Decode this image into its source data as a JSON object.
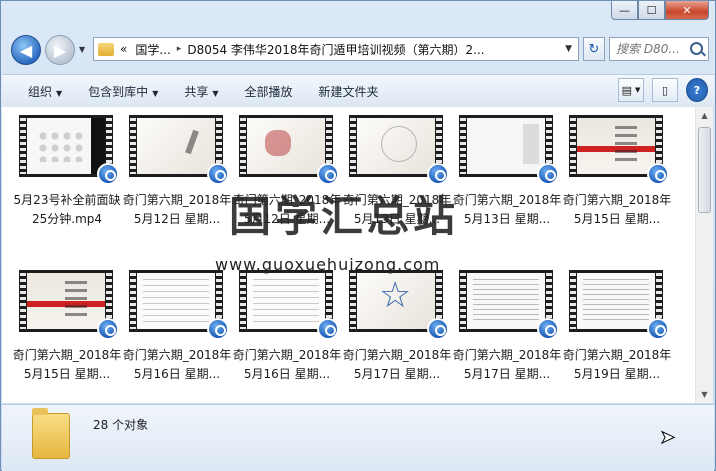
{
  "window": {
    "min": "—",
    "max": "☐",
    "close": "✕"
  },
  "nav": {
    "back": "◀",
    "forward": "▶",
    "dropdown": "▼",
    "refresh": "↻"
  },
  "address": {
    "breadcrumbs": [
      "«",
      "国学...",
      "D8054 李伟华2018年奇门遁甲培训视频（第六期）2..."
    ],
    "separator": "▸",
    "dropdown": "▼"
  },
  "search": {
    "placeholder": "搜索 D80..."
  },
  "toolbar": {
    "items": [
      "组织",
      "包含到库中",
      "共享",
      "全部播放",
      "新建文件夹"
    ],
    "arrow": "▼"
  },
  "files": [
    {
      "name": "5月23号补全前面缺25分钟.mp4",
      "thumb": "phone"
    },
    {
      "name": "奇门第六期_2018年5月12日 星期...",
      "thumb": "ink"
    },
    {
      "name": "奇门第六期_2018年5月12日 星期...",
      "thumb": "red"
    },
    {
      "name": "奇门第六期_2018年5月13日 星期...",
      "thumb": "circle"
    },
    {
      "name": "奇门第六期_2018年5月13日 星期...",
      "thumb": "plain"
    },
    {
      "name": "奇门第六期_2018年5月15日 星期...",
      "thumb": "qimen"
    },
    {
      "name": "奇门第六期_2018年5月15日 星期...",
      "thumb": "qimen"
    },
    {
      "name": "奇门第六期_2018年5月16日 星期...",
      "thumb": "doc"
    },
    {
      "name": "奇门第六期_2018年5月16日 星期...",
      "thumb": "doc"
    },
    {
      "name": "奇门第六期_2018年5月17日 星期...",
      "thumb": "star"
    },
    {
      "name": "奇门第六期_2018年5月17日 星期...",
      "thumb": "hand"
    },
    {
      "name": "奇门第六期_2018年5月19日 星期...",
      "thumb": "hand"
    }
  ],
  "status": {
    "count": "28 个对象"
  },
  "watermark": {
    "text": "国学汇总站",
    "url": "www.guoxuehuizong.com"
  }
}
